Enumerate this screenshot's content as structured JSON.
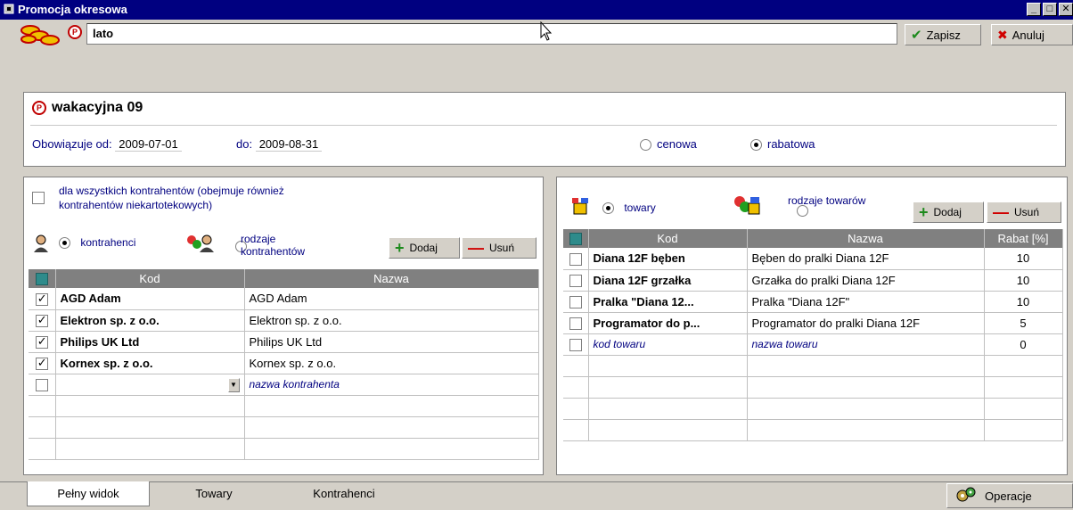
{
  "window": {
    "title": "Promocja okresowa",
    "controls": {
      "minimize": "_",
      "maximize": "□",
      "close": "✕"
    }
  },
  "toolbar": {
    "name_value": "lato",
    "save_label": "Zapisz",
    "cancel_label": "Anuluj"
  },
  "header": {
    "promo_badge": "P",
    "promo_name": "wakacyjna 09",
    "valid_from_label": "Obowiązuje od:",
    "valid_from_value": "2009-07-01",
    "valid_to_label": "do:",
    "valid_to_value": "2009-08-31",
    "type_options": [
      {
        "label": "cenowa",
        "selected": false
      },
      {
        "label": "rabatowa",
        "selected": true
      }
    ]
  },
  "contractors": {
    "all_label": "dla wszystkich kontrahentów (obejmuje również kontrahentów niekartotekowych)",
    "radio_contractors": "kontrahenci",
    "radio_types": "rodzaje kontrahentów",
    "add_label": "Dodaj",
    "remove_label": "Usuń",
    "columns": [
      "Kod",
      "Nazwa"
    ],
    "rows": [
      {
        "checked": true,
        "code": "AGD Adam",
        "name": "AGD Adam"
      },
      {
        "checked": true,
        "code": "Elektron sp. z o.o.",
        "name": "Elektron sp. z o.o."
      },
      {
        "checked": true,
        "code": "Philips UK Ltd",
        "name": "Philips UK Ltd"
      },
      {
        "checked": true,
        "code": "Kornex sp. z o.o.",
        "name": "Kornex sp. z o.o."
      }
    ],
    "new_row_placeholder_name": "nazwa kontrahenta"
  },
  "products": {
    "radio_goods": "towary",
    "radio_goods_types": "rodzaje towarów",
    "add_label": "Dodaj",
    "remove_label": "Usuń",
    "columns": [
      "Kod",
      "Nazwa",
      "Rabat [%]"
    ],
    "rows": [
      {
        "code": "Diana 12F bęben",
        "name": "Bęben do pralki Diana 12F",
        "discount": "10"
      },
      {
        "code": "Diana 12F grzałka",
        "name": "Grzałka do pralki Diana 12F",
        "discount": "10"
      },
      {
        "code": "Pralka \"Diana 12...",
        "name": "Pralka \"Diana 12F\"",
        "discount": "10"
      },
      {
        "code": "Programator do p...",
        "name": "Programator do pralki Diana 12F",
        "discount": "5"
      }
    ],
    "new_row": {
      "code_placeholder": "kod towaru",
      "name_placeholder": "nazwa towaru",
      "discount": "0"
    }
  },
  "tabs": [
    "Pełny widok",
    "Towary",
    "Kontrahenci"
  ],
  "operations_label": "Operacje",
  "colors": {
    "titlebar": "#000080",
    "face": "#d4d0c8",
    "grid_header": "#808080",
    "accent_text": "#000080"
  }
}
